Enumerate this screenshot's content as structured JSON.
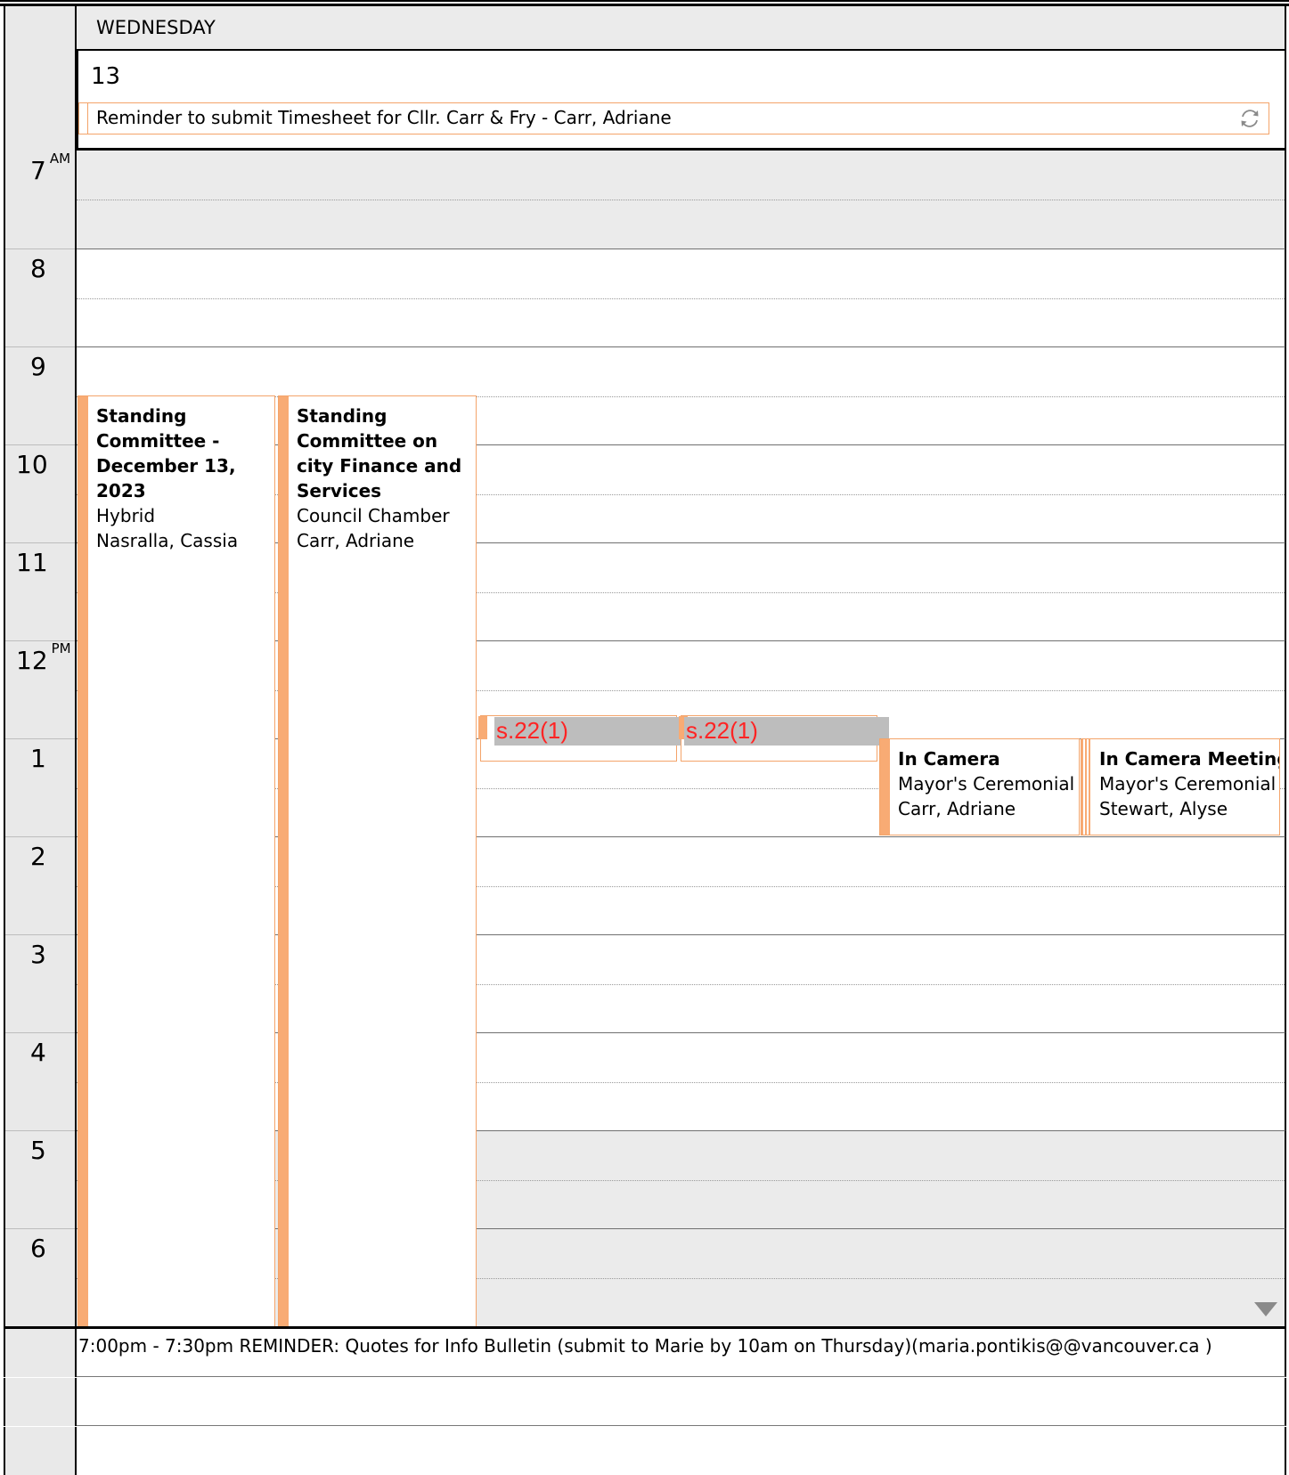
{
  "day": {
    "weekday": "WEDNESDAY",
    "date_number": "13"
  },
  "all_day_event": {
    "text": "Reminder to submit Timesheet for Cllr. Carr & Fry - Carr, Adriane",
    "icon": "recurring-sync-icon"
  },
  "hours": [
    {
      "label": "7",
      "suffix": "AM"
    },
    {
      "label": "8",
      "suffix": ""
    },
    {
      "label": "9",
      "suffix": ""
    },
    {
      "label": "10",
      "suffix": ""
    },
    {
      "label": "11",
      "suffix": ""
    },
    {
      "label": "12",
      "suffix": "PM"
    },
    {
      "label": "1",
      "suffix": ""
    },
    {
      "label": "2",
      "suffix": ""
    },
    {
      "label": "3",
      "suffix": ""
    },
    {
      "label": "4",
      "suffix": ""
    },
    {
      "label": "5",
      "suffix": ""
    },
    {
      "label": "6",
      "suffix": ""
    }
  ],
  "appointments": [
    {
      "title": "Standing Committee - December 13, 2023",
      "lines": [
        "Hybrid",
        "Nasralla, Cassia"
      ]
    },
    {
      "title": "Standing Committee on city Finance and Services",
      "lines": [
        "Council Chamber",
        "Carr, Adriane"
      ]
    },
    {
      "title": "In Camera",
      "lines": [
        "Mayor's Ceremonial I",
        "Carr, Adriane"
      ]
    },
    {
      "title": "In Camera Meeting",
      "lines": [
        "Mayor's Ceremonial I",
        "Stewart, Alyse"
      ]
    }
  ],
  "redactions": [
    {
      "label": "s.22(1)"
    },
    {
      "label": "s.22(1)"
    }
  ],
  "evening_reminder": {
    "text": "7:00pm - 7:30pm REMINDER: Quotes for Info Bulletin (submit to Marie by 10am on Thursday)(maria.pontikis@@vancouver.ca )"
  },
  "colors": {
    "accent_orange": "#f8ab74",
    "non_working_gray": "#ebebeb",
    "redaction_gray": "#bdbdbd",
    "redaction_text": "#ff2424"
  }
}
